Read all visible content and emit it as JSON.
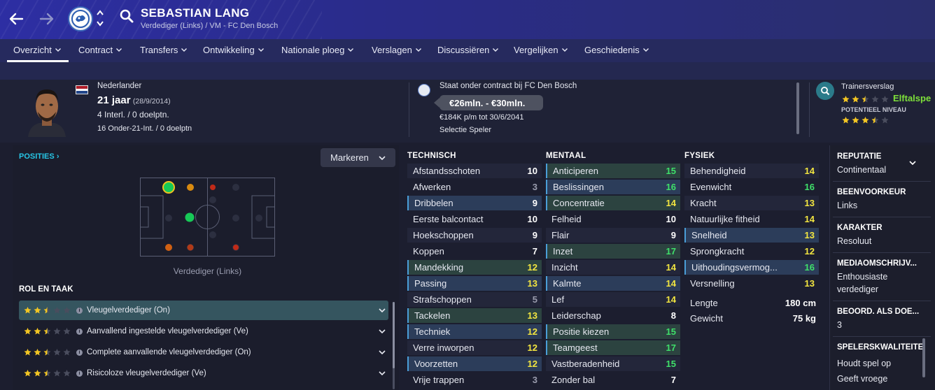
{
  "header": {
    "player_name": "SEBASTIAN LANG",
    "subtitle": "Verdediger (Links) / VM - FC Den Bosch"
  },
  "tabs": [
    {
      "label": "Overzicht"
    },
    {
      "label": "Contract"
    },
    {
      "label": "Transfers"
    },
    {
      "label": "Ontwikkeling"
    },
    {
      "label": "Nationale ploeg"
    },
    {
      "label": "Verslagen"
    },
    {
      "label": "Discussiëren"
    },
    {
      "label": "Vergelijken"
    },
    {
      "label": "Geschiedenis"
    }
  ],
  "profile": {
    "nationality": "Nederlander",
    "age": "21 jaar",
    "dob": "(28/9/2014)",
    "caps": "4 Interl. / 0 doelptn.",
    "u21_caps": "16 Onder-21-Int. / 0 doelptn",
    "contract_status": "Staat onder contract bij FC Den Bosch",
    "value": "€26mln. - €30mln.",
    "wage": "€184K p/m tot 30/6/2041",
    "squad_status": "Selectie Speler",
    "coach_report_label": "Trainersverslag",
    "current_ability_text": "Elftalspe",
    "potential_label": "POTENTIEEL NIVEAU",
    "current_stars": 2.5,
    "potential_stars": 3.5
  },
  "positions": {
    "header": "POSITIES",
    "caption": "Verdediger (Links)",
    "mark_button": "Markeren"
  },
  "roles": {
    "header": "ROL EN TAAK",
    "items": [
      {
        "label": "Vleugelverdediger (On)",
        "stars": 2.5
      },
      {
        "label": "Aanvallend ingestelde vleugelverdediger (Ve)",
        "stars": 2.5
      },
      {
        "label": "Complete aanvallende vleugelverdediger (On)",
        "stars": 2.5
      },
      {
        "label": "Risicoloze vleugelverdediger (Ve)",
        "stars": 2.5
      }
    ]
  },
  "attributes": {
    "technical": {
      "header": "TECHNISCH",
      "items": [
        {
          "name": "Afstandsschoten",
          "value": "10"
        },
        {
          "name": "Afwerken",
          "value": "3"
        },
        {
          "name": "Dribbelen",
          "value": "9"
        },
        {
          "name": "Eerste balcontact",
          "value": "10"
        },
        {
          "name": "Hoekschoppen",
          "value": "9"
        },
        {
          "name": "Koppen",
          "value": "7"
        },
        {
          "name": "Mandekking",
          "value": "12"
        },
        {
          "name": "Passing",
          "value": "13"
        },
        {
          "name": "Strafschoppen",
          "value": "5"
        },
        {
          "name": "Tackelen",
          "value": "13"
        },
        {
          "name": "Techniek",
          "value": "12"
        },
        {
          "name": "Verre inworpen",
          "value": "12"
        },
        {
          "name": "Voorzetten",
          "value": "12"
        },
        {
          "name": "Vrije trappen",
          "value": "3"
        }
      ]
    },
    "mental": {
      "header": "MENTAAL",
      "items": [
        {
          "name": "Anticiperen",
          "value": "15"
        },
        {
          "name": "Beslissingen",
          "value": "16"
        },
        {
          "name": "Concentratie",
          "value": "14"
        },
        {
          "name": "Felheid",
          "value": "10"
        },
        {
          "name": "Flair",
          "value": "9"
        },
        {
          "name": "Inzet",
          "value": "17"
        },
        {
          "name": "Inzicht",
          "value": "14"
        },
        {
          "name": "Kalmte",
          "value": "14"
        },
        {
          "name": "Lef",
          "value": "14"
        },
        {
          "name": "Leiderschap",
          "value": "8"
        },
        {
          "name": "Positie kiezen",
          "value": "15"
        },
        {
          "name": "Teamgeest",
          "value": "17"
        },
        {
          "name": "Vastberadenheid",
          "value": "15"
        },
        {
          "name": "Zonder bal",
          "value": "7"
        }
      ]
    },
    "physical": {
      "header": "FYSIEK",
      "items": [
        {
          "name": "Behendigheid",
          "value": "14"
        },
        {
          "name": "Evenwicht",
          "value": "16"
        },
        {
          "name": "Kracht",
          "value": "13"
        },
        {
          "name": "Natuurlijke fitheid",
          "value": "14"
        },
        {
          "name": "Snelheid",
          "value": "13"
        },
        {
          "name": "Sprongkracht",
          "value": "12"
        },
        {
          "name": "Uithoudingsvermog...",
          "value": "16"
        },
        {
          "name": "Versnelling",
          "value": "13"
        }
      ],
      "length_label": "Lengte",
      "length_value": "180 cm",
      "weight_label": "Gewicht",
      "weight_value": "75 kg"
    }
  },
  "info": {
    "reputation_label": "REPUTATIE",
    "reputation_value": "Continentaal",
    "foot_label": "BEENVOORKEUR",
    "foot_value": "Links",
    "character_label": "KARAKTER",
    "character_value": "Resoluut",
    "media_label": "MEDIAOMSCHRIJV...",
    "media_value_1": "Enthousiaste",
    "media_value_2": "verdediger",
    "rating_label": "BEOORD. ALS DOE...",
    "rating_value": "3",
    "traits_label": "SPELERSKWALITEITE",
    "trait_1": "Houdt spel op",
    "trait_2": "Geeft vroege"
  },
  "colors": {
    "accent_cyan": "#27c6e6",
    "attr_yellow": "#f3e640",
    "attr_green": "#3fe06a",
    "header_blue": "#2d2ea3"
  }
}
